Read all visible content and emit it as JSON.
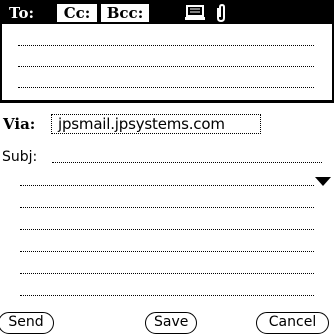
{
  "header": {
    "tabs": [
      {
        "label": "To:"
      },
      {
        "label": "Cc:"
      },
      {
        "label": "Bcc:"
      }
    ],
    "icons": [
      "address-book-icon",
      "attachment-icon"
    ]
  },
  "compose": {
    "via_label": "Via:",
    "via_value": "jpsmail.jpsystems.com",
    "subject_label": "Subj:",
    "subject_value": ""
  },
  "buttons": {
    "send": "Send",
    "save": "Save",
    "cancel": "Cancel"
  }
}
